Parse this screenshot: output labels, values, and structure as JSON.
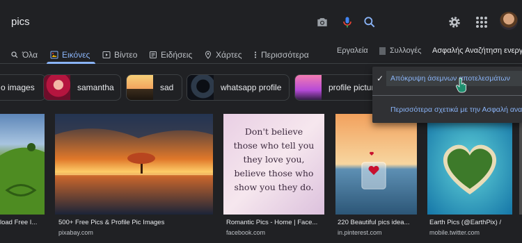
{
  "search": {
    "query": "pics"
  },
  "header_icons": {
    "camera": "camera-icon",
    "mic": "microphone-icon",
    "search": "search-icon",
    "settings": "gear-icon",
    "apps": "apps-grid-icon",
    "avatar": "user-avatar"
  },
  "tabs": [
    {
      "label": "Όλα",
      "icon": "search-icon"
    },
    {
      "label": "Εικόνες",
      "icon": "image-icon",
      "active": true
    },
    {
      "label": "Βίντεο",
      "icon": "play-icon"
    },
    {
      "label": "Ειδήσεις",
      "icon": "news-icon"
    },
    {
      "label": "Χάρτες",
      "icon": "map-pin-icon"
    },
    {
      "label": "Περισσότερα",
      "icon": "more-vert-icon"
    }
  ],
  "toolbar": {
    "tools": "Εργαλεία",
    "collections": "Συλλογές",
    "safesearch": "Ασφαλής Αναζήτηση ενεργ"
  },
  "chips": [
    {
      "label": "o images"
    },
    {
      "label": "samantha"
    },
    {
      "label": "sad"
    },
    {
      "label": "whatsapp profile"
    },
    {
      "label": "profile pictur"
    }
  ],
  "results": [
    {
      "caption": "load Free I...",
      "source": ""
    },
    {
      "caption": "500+ Free Pics & Profile Pic Images",
      "source": "pixabay.com"
    },
    {
      "caption": "Romantic Pics - Home | Face...",
      "source": "facebook.com",
      "quote": [
        "Don't believe",
        "those who tell you",
        "they love you,",
        "believe those who",
        "show you they do."
      ]
    },
    {
      "caption": "220 Beautiful pics idea...",
      "source": "in.pinterest.com"
    },
    {
      "caption": "Earth Pics (@EarthPix) /",
      "source": "mobile.twitter.com"
    },
    {
      "caption": "",
      "source": ""
    }
  ],
  "dropdown": {
    "item1": "Απόκρυψη άσεμνων αποτελεσμάτων",
    "item1_checked": true,
    "item2": "Περισσότερα σχετικά με την Ασφαλή ανα"
  },
  "colors": {
    "background": "#202124",
    "accent": "#8ab4f8",
    "text": "#e8eaed",
    "muted": "#bdc1c6",
    "menu": "#303134"
  }
}
